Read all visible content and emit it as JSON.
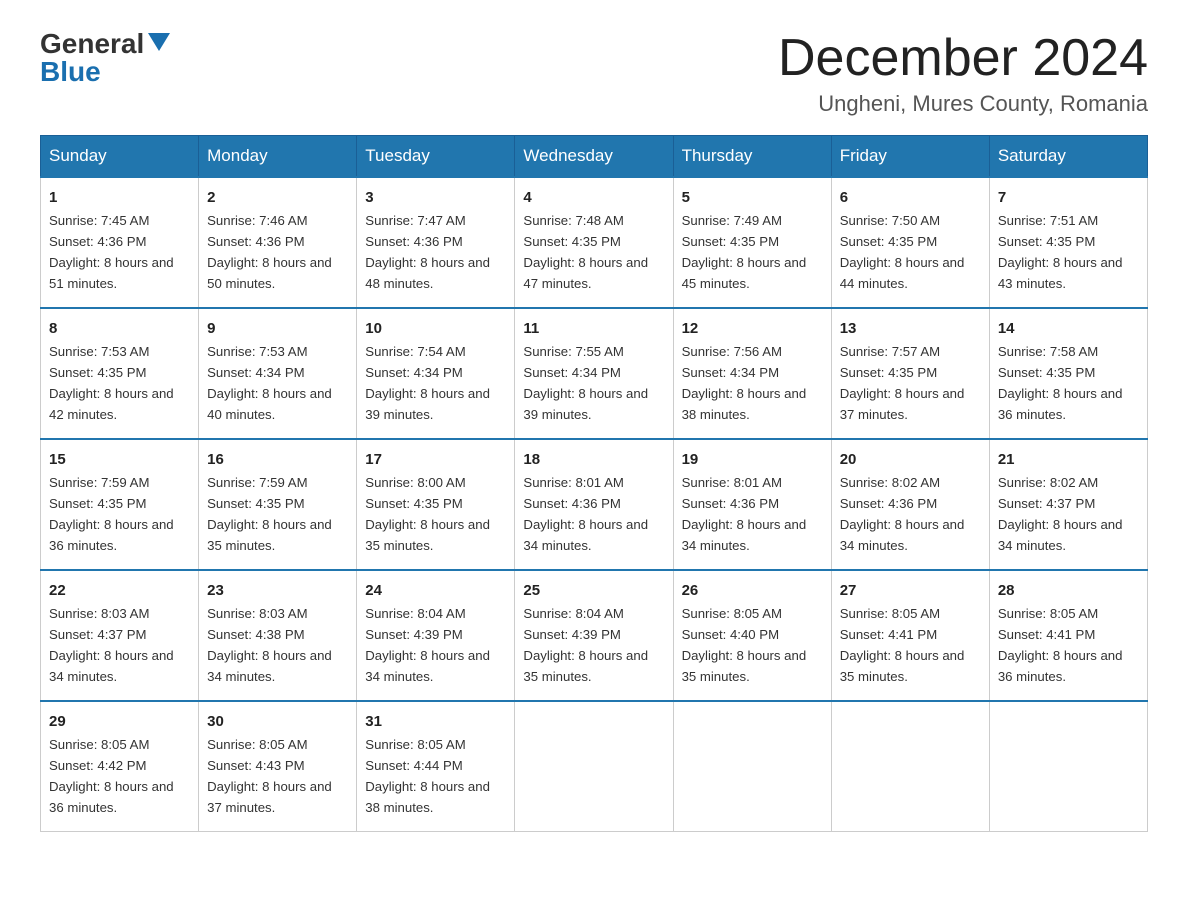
{
  "header": {
    "logo_general": "General",
    "logo_blue": "Blue",
    "month_title": "December 2024",
    "location": "Ungheni, Mures County, Romania"
  },
  "days_of_week": [
    "Sunday",
    "Monday",
    "Tuesday",
    "Wednesday",
    "Thursday",
    "Friday",
    "Saturday"
  ],
  "weeks": [
    [
      {
        "day": "1",
        "sunrise": "7:45 AM",
        "sunset": "4:36 PM",
        "daylight": "8 hours and 51 minutes."
      },
      {
        "day": "2",
        "sunrise": "7:46 AM",
        "sunset": "4:36 PM",
        "daylight": "8 hours and 50 minutes."
      },
      {
        "day": "3",
        "sunrise": "7:47 AM",
        "sunset": "4:36 PM",
        "daylight": "8 hours and 48 minutes."
      },
      {
        "day": "4",
        "sunrise": "7:48 AM",
        "sunset": "4:35 PM",
        "daylight": "8 hours and 47 minutes."
      },
      {
        "day": "5",
        "sunrise": "7:49 AM",
        "sunset": "4:35 PM",
        "daylight": "8 hours and 45 minutes."
      },
      {
        "day": "6",
        "sunrise": "7:50 AM",
        "sunset": "4:35 PM",
        "daylight": "8 hours and 44 minutes."
      },
      {
        "day": "7",
        "sunrise": "7:51 AM",
        "sunset": "4:35 PM",
        "daylight": "8 hours and 43 minutes."
      }
    ],
    [
      {
        "day": "8",
        "sunrise": "7:53 AM",
        "sunset": "4:35 PM",
        "daylight": "8 hours and 42 minutes."
      },
      {
        "day": "9",
        "sunrise": "7:53 AM",
        "sunset": "4:34 PM",
        "daylight": "8 hours and 40 minutes."
      },
      {
        "day": "10",
        "sunrise": "7:54 AM",
        "sunset": "4:34 PM",
        "daylight": "8 hours and 39 minutes."
      },
      {
        "day": "11",
        "sunrise": "7:55 AM",
        "sunset": "4:34 PM",
        "daylight": "8 hours and 39 minutes."
      },
      {
        "day": "12",
        "sunrise": "7:56 AM",
        "sunset": "4:34 PM",
        "daylight": "8 hours and 38 minutes."
      },
      {
        "day": "13",
        "sunrise": "7:57 AM",
        "sunset": "4:35 PM",
        "daylight": "8 hours and 37 minutes."
      },
      {
        "day": "14",
        "sunrise": "7:58 AM",
        "sunset": "4:35 PM",
        "daylight": "8 hours and 36 minutes."
      }
    ],
    [
      {
        "day": "15",
        "sunrise": "7:59 AM",
        "sunset": "4:35 PM",
        "daylight": "8 hours and 36 minutes."
      },
      {
        "day": "16",
        "sunrise": "7:59 AM",
        "sunset": "4:35 PM",
        "daylight": "8 hours and 35 minutes."
      },
      {
        "day": "17",
        "sunrise": "8:00 AM",
        "sunset": "4:35 PM",
        "daylight": "8 hours and 35 minutes."
      },
      {
        "day": "18",
        "sunrise": "8:01 AM",
        "sunset": "4:36 PM",
        "daylight": "8 hours and 34 minutes."
      },
      {
        "day": "19",
        "sunrise": "8:01 AM",
        "sunset": "4:36 PM",
        "daylight": "8 hours and 34 minutes."
      },
      {
        "day": "20",
        "sunrise": "8:02 AM",
        "sunset": "4:36 PM",
        "daylight": "8 hours and 34 minutes."
      },
      {
        "day": "21",
        "sunrise": "8:02 AM",
        "sunset": "4:37 PM",
        "daylight": "8 hours and 34 minutes."
      }
    ],
    [
      {
        "day": "22",
        "sunrise": "8:03 AM",
        "sunset": "4:37 PM",
        "daylight": "8 hours and 34 minutes."
      },
      {
        "day": "23",
        "sunrise": "8:03 AM",
        "sunset": "4:38 PM",
        "daylight": "8 hours and 34 minutes."
      },
      {
        "day": "24",
        "sunrise": "8:04 AM",
        "sunset": "4:39 PM",
        "daylight": "8 hours and 34 minutes."
      },
      {
        "day": "25",
        "sunrise": "8:04 AM",
        "sunset": "4:39 PM",
        "daylight": "8 hours and 35 minutes."
      },
      {
        "day": "26",
        "sunrise": "8:05 AM",
        "sunset": "4:40 PM",
        "daylight": "8 hours and 35 minutes."
      },
      {
        "day": "27",
        "sunrise": "8:05 AM",
        "sunset": "4:41 PM",
        "daylight": "8 hours and 35 minutes."
      },
      {
        "day": "28",
        "sunrise": "8:05 AM",
        "sunset": "4:41 PM",
        "daylight": "8 hours and 36 minutes."
      }
    ],
    [
      {
        "day": "29",
        "sunrise": "8:05 AM",
        "sunset": "4:42 PM",
        "daylight": "8 hours and 36 minutes."
      },
      {
        "day": "30",
        "sunrise": "8:05 AM",
        "sunset": "4:43 PM",
        "daylight": "8 hours and 37 minutes."
      },
      {
        "day": "31",
        "sunrise": "8:05 AM",
        "sunset": "4:44 PM",
        "daylight": "8 hours and 38 minutes."
      },
      null,
      null,
      null,
      null
    ]
  ],
  "labels": {
    "sunrise_prefix": "Sunrise: ",
    "sunset_prefix": "Sunset: ",
    "daylight_prefix": "Daylight: "
  }
}
